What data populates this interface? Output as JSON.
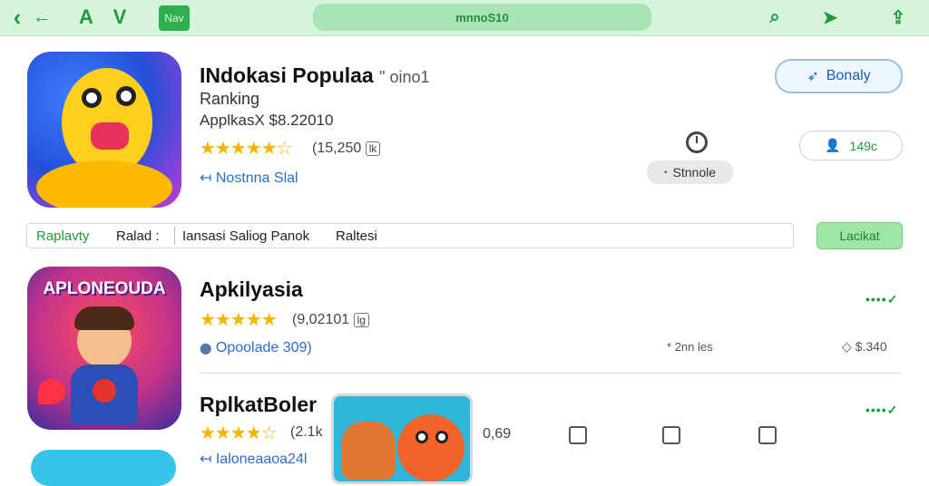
{
  "topbar": {
    "back_icon": "‹",
    "forward_icon": "←",
    "logo_a": "A",
    "logo_v": "V",
    "nav_chip": "Nav",
    "url": "mnnoS10",
    "search_icon": "⌕",
    "send_icon": "➤",
    "share_icon": "⇪"
  },
  "app1": {
    "title": "INdokasi Populaa",
    "title_suffix": "\" oino1",
    "subtitle": "Ranking",
    "price": "ApplkasX $8.22010",
    "stars": "★★★★★☆",
    "rating": "(15,250",
    "rating_badge": "lk",
    "link": "Nostnna Slal",
    "link_icon": "↤",
    "install_label": "Bonaly",
    "install_icon": "➶",
    "clock_label": "Stnnole",
    "user_count": "149c",
    "user_icon": "👤"
  },
  "filterbar": {
    "items": [
      "Raplavty",
      "Ralad :",
      "Iansasi Saliog Panok",
      "Raltesi"
    ],
    "action": "Lacikat"
  },
  "app2": {
    "title": "Apkilyasia",
    "icon_text": "APLONEOUDA",
    "stars": "★★★★★",
    "rating": "(9,02101",
    "rating_badge": "lg",
    "link": "Opoolade 309)",
    "link_icon": "⬤",
    "meta1": "* 2nn les",
    "meta2": "$.340",
    "meta2_icon": "◇",
    "status": "••••✓"
  },
  "app3": {
    "title": "RplkatBoler",
    "stars": "★★★★☆",
    "rating": "(2.1k",
    "link": "Ialoneaaoa24l",
    "link_icon": "↤",
    "value": "0,69",
    "status": "••••✓"
  }
}
